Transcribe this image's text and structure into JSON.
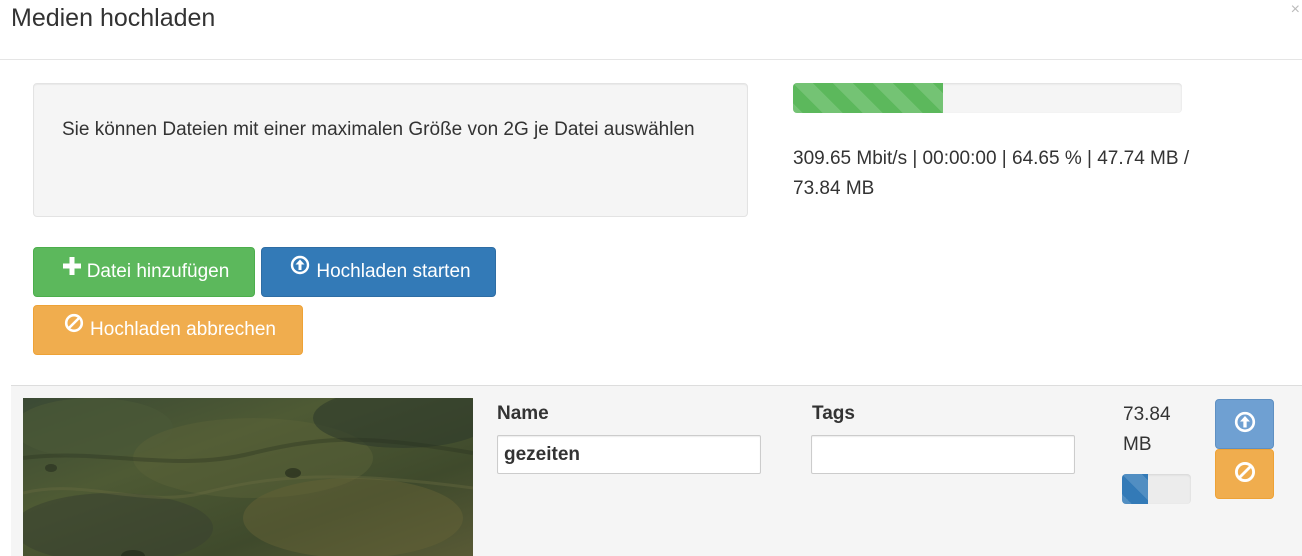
{
  "modal": {
    "title": "Medien hochladen",
    "close_symbol": "×"
  },
  "info": {
    "text": "Sie können Dateien mit einer maximalen Größe von 2G je Datei auswählen"
  },
  "global_progress": {
    "percent": 38.5,
    "color": "#5cb85c"
  },
  "progress_extended": {
    "text": "309.65 Mbit/s | 00:00:00 | 64.65 % | 47.74 MB / 73.84 MB"
  },
  "toolbar": {
    "add_label": "Datei hinzufügen",
    "add_icon": "plus-icon",
    "start_label": "Hochladen starten",
    "start_icon": "circle-arrow-up-icon",
    "cancel_label": "Hochladen abbrechen",
    "cancel_icon": "ban-circle-icon"
  },
  "file": {
    "name_label": "Name",
    "name_value": "gezeiten",
    "tags_label": "Tags",
    "tags_value": "",
    "size_line1": "73.84",
    "size_line2": "MB",
    "progress_percent": 38,
    "progress_color": "#337ab7",
    "start_icon": "circle-arrow-up-icon",
    "cancel_icon": "ban-circle-icon"
  }
}
